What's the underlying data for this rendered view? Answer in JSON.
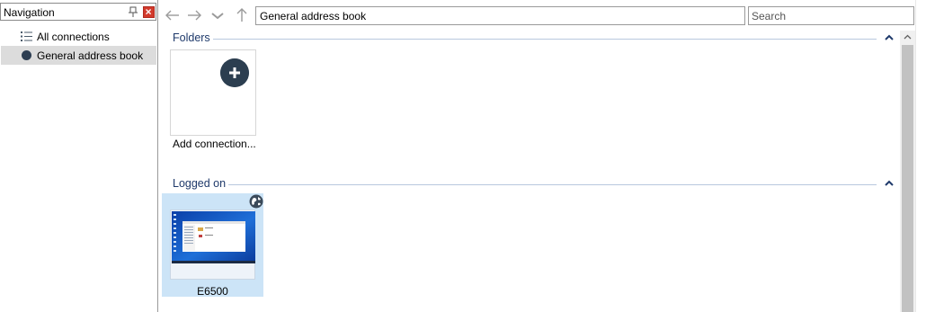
{
  "navigation": {
    "title": "Navigation",
    "items": [
      {
        "label": "All connections",
        "icon": "list-icon",
        "selected": false
      },
      {
        "label": "General address book",
        "icon": "dot-icon",
        "selected": true
      }
    ]
  },
  "toolbar": {
    "address": "General address book",
    "search_placeholder": "Search"
  },
  "groups": {
    "folders": {
      "title": "Folders",
      "add_label": "Add connection..."
    },
    "logged_on": {
      "title": "Logged on",
      "tile_label": "E6500"
    }
  },
  "colors": {
    "accent": "#1f3a6b",
    "selected_tile": "#cce4f7",
    "close_red": "#d23a2c",
    "icon_dark": "#2c3e50"
  }
}
